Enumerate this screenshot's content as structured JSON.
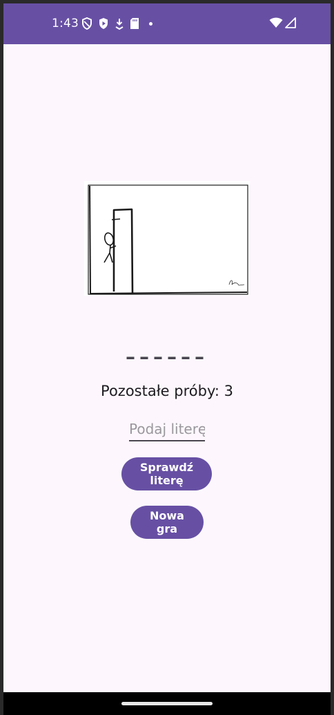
{
  "status_bar": {
    "time": "1:43",
    "background_color": "#6750a4",
    "icons_left": [
      "shield-icon",
      "play-protect-icon",
      "download-icon",
      "sd-card-icon",
      "notification-dot-icon"
    ],
    "icons_right": [
      "wifi-icon",
      "signal-icon"
    ]
  },
  "game": {
    "image": "hangman-drawing",
    "word_mask": "––––––",
    "attempts_text": "Pozostałe próby: 3",
    "input_placeholder": "Podaj literę",
    "input_value": ""
  },
  "buttons": {
    "check_label": "Sprawdź literę",
    "new_game_label": "Nowa gra"
  },
  "colors": {
    "accent": "#6750a4",
    "background": "#fdf7fd"
  }
}
